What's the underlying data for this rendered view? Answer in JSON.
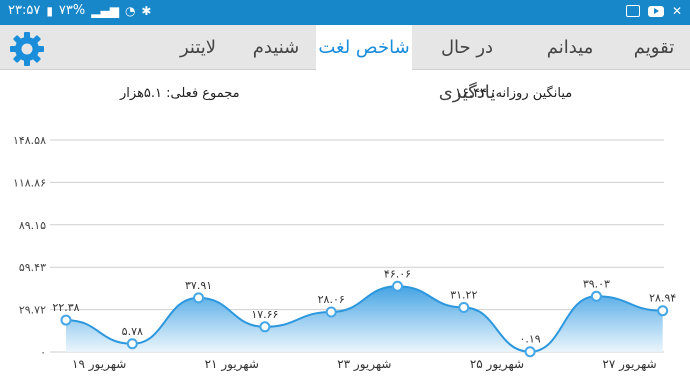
{
  "status_bar": {
    "time": "۲۳:۵۷",
    "battery": "۷۳%",
    "icons": [
      "battery-icon",
      "signal-icon",
      "wifi-icon",
      "bluetooth-icon",
      "image-icon",
      "youtube-icon",
      "x-icon"
    ]
  },
  "tabs": [
    {
      "label": "تقویم",
      "active": false
    },
    {
      "label": "میدانم",
      "active": false
    },
    {
      "label": "در حال یادگیری",
      "active": false
    },
    {
      "label": "شاخص لغت",
      "active": true
    },
    {
      "label": "شنیدم",
      "active": false
    },
    {
      "label": "لایتنر",
      "active": false
    }
  ],
  "summary": {
    "daily_average": "میانگین روزانه: ۱۶.۴۴",
    "actual_total": "مجموع فعلی: ۵.۱هزار"
  },
  "colors": {
    "accent": "#1a8ddb",
    "status_bar": "#1787c9",
    "tab_bg": "#e6e6e6",
    "line": "#2c97dd"
  },
  "chart_data": {
    "type": "area",
    "y_tick_labels": [
      "۰",
      "۲۹.۷۲",
      "۵۹.۴۳",
      "۸۹.۱۵",
      "۱۱۸.۸۶",
      "۱۴۸.۵۸"
    ],
    "y_ticks": [
      0,
      29.72,
      59.43,
      89.15,
      118.86,
      148.58
    ],
    "ylim": [
      0,
      148.58
    ],
    "x_tick_labels": [
      "۱۹ شهریور",
      "۲۱ شهریور",
      "۲۳ شهریور",
      "۲۵ شهریور",
      "۲۷ شهریور"
    ],
    "points": [
      {
        "value": 22.38,
        "label": "۲۲.۳۸"
      },
      {
        "value": 5.78,
        "label": "۵.۷۸"
      },
      {
        "value": 37.91,
        "label": "۳۷.۹۱"
      },
      {
        "value": 17.66,
        "label": "۱۷.۶۶"
      },
      {
        "value": 28.06,
        "label": "۲۸.۰۶"
      },
      {
        "value": 46.06,
        "label": "۴۶.۰۶"
      },
      {
        "value": 31.22,
        "label": "۳۱.۲۲"
      },
      {
        "value": 0.19,
        "label": "۰.۱۹"
      },
      {
        "value": 39.03,
        "label": "۳۹.۰۳"
      },
      {
        "value": 28.94,
        "label": "۲۸.۹۴"
      }
    ],
    "grid": true,
    "smooth": true
  }
}
